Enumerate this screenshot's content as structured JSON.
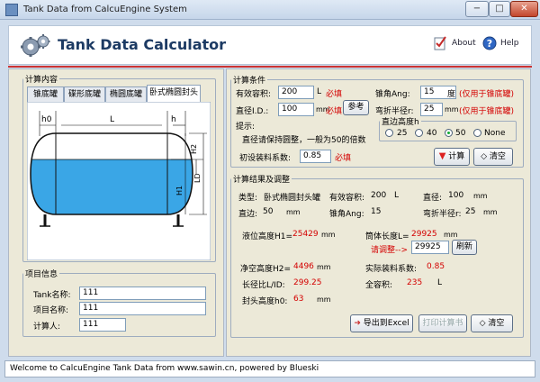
{
  "window": {
    "title": "Tank Data from CalcuEngine System",
    "min_glyph": "−",
    "max_glyph": "□",
    "close_glyph": "✕"
  },
  "header": {
    "app_title": "Tank Data Calculator",
    "about": "About",
    "help": "Help"
  },
  "left": {
    "group_title": "计算内容",
    "tabs": [
      {
        "label": "锥底罐"
      },
      {
        "label": "碟形底罐"
      },
      {
        "label": "椭圆底罐"
      },
      {
        "label": "卧式椭圆封头"
      }
    ],
    "diagram": {
      "h0": "h0",
      "L": "L",
      "h": "h",
      "H2": "H2",
      "H1": "H1",
      "LD": "LD"
    },
    "project": {
      "group_title": "项目信息",
      "tank_name_label": "Tank名称:",
      "tank_name_value": "111",
      "project_name_label": "项目名称:",
      "project_name_value": "111",
      "calculator_label": "计算人:",
      "calculator_value": "111"
    }
  },
  "conditions": {
    "group_title": "计算条件",
    "volume_label": "有效容积:",
    "volume_value": "200",
    "volume_unit": "L",
    "volume_required": "必填",
    "diameter_label": "直径I.D.:",
    "diameter_value": "100",
    "diameter_unit": "mm",
    "diameter_required": "必填",
    "ref_button": "参考",
    "hint_label": "提示:",
    "hint_text": "直径请保持圆整，一般为50的倍数",
    "fill_label": "初设装料系数:",
    "fill_value": "0.85",
    "fill_required": "必填",
    "cone_angle_label": "锥角Ang:",
    "cone_angle_value": "15",
    "cone_angle_unit": "度",
    "cone_angle_note": "(仅用于锥底罐)",
    "bend_radius_label": "弯折半径r:",
    "bend_radius_value": "25",
    "bend_radius_unit": "mm",
    "bend_radius_note": "(仅用于锥底罐)",
    "straight_group": "直边高度h",
    "straight_options": [
      "25",
      "40",
      "50",
      "None"
    ],
    "straight_selected": "50",
    "calc_button": "计算",
    "clear_button": "清空"
  },
  "results": {
    "group_title": "计算结果及调整",
    "type_label": "类型:",
    "type_value": "卧式椭圆封头罐",
    "volume_label": "有效容积:",
    "volume_value": "200",
    "volume_unit": "L",
    "diameter_label": "直径:",
    "diameter_value": "100",
    "diameter_unit": "mm",
    "straight_label": "直边:",
    "straight_value": "50",
    "straight_unit": "mm",
    "angle_label": "锥角Ang:",
    "angle_value": "15",
    "bend_label": "弯折半径r:",
    "bend_value": "25",
    "bend_unit": "mm",
    "liquid_label": "液位高度H1=",
    "liquid_value": "25429",
    "liquid_unit": "mm",
    "body_len_label": "筒体长度L=",
    "body_len_value": "29925",
    "body_len_unit": "mm",
    "adjust_label": "请调整-->",
    "adjust_value": "29925",
    "refresh_button": "刷新",
    "headspace_label": "净空高度H2=",
    "headspace_value": "4496",
    "headspace_unit": "mm",
    "actual_fill_label": "实际装料系数:",
    "actual_fill_value": "0.85",
    "ratio_label": "长径比L/ID:",
    "ratio_value": "299.25",
    "total_label": "全容积:",
    "total_value": "235",
    "total_unit": "L",
    "head_label": "封头高度h0:",
    "head_value": "63",
    "head_unit": "mm",
    "export_button": "导出到Excel",
    "print_button": "打印计算书",
    "clear_button": "清空"
  },
  "status": {
    "text": "Welcome to CalcuEngine Tank Data from www.sawin.cn, powered by Blueski"
  },
  "colors": {
    "required_red": "#d40000",
    "title_blue": "#1c3a63",
    "liquid": "#3aa6e6"
  }
}
